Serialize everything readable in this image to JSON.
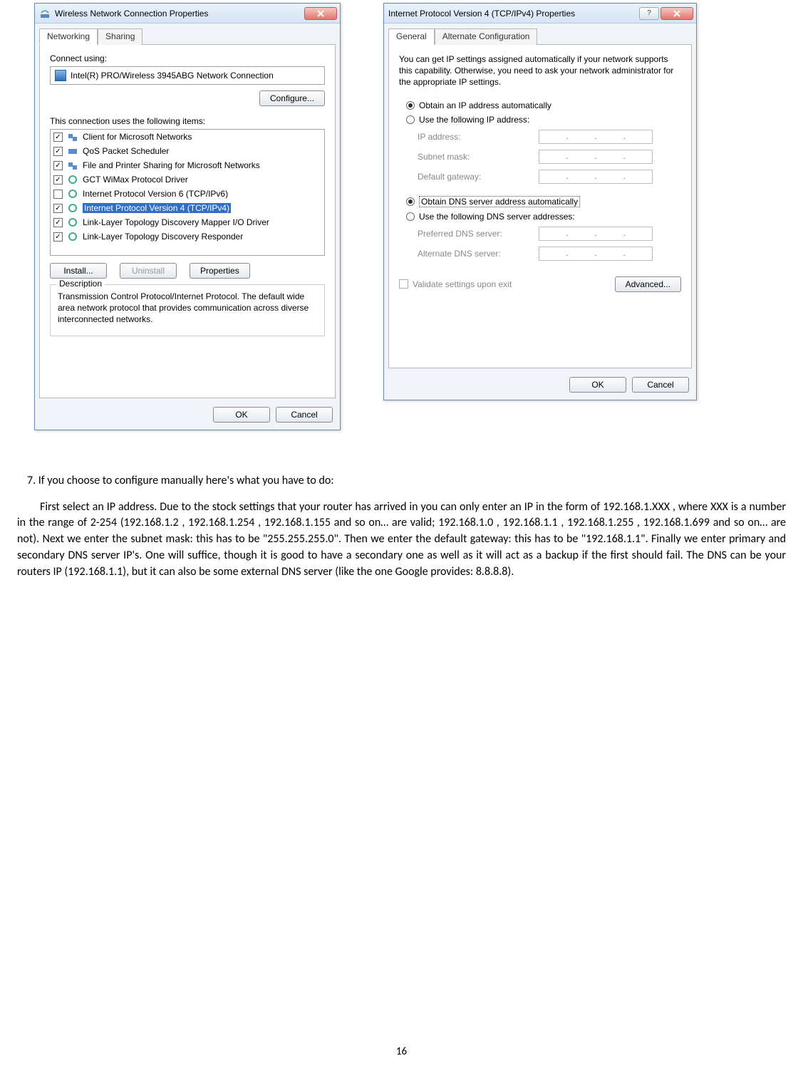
{
  "dialog1": {
    "title": "Wireless Network Connection Properties",
    "tabs": {
      "networking": "Networking",
      "sharing": "Sharing"
    },
    "connect_using_label": "Connect using:",
    "adapter": "Intel(R) PRO/Wireless 3945ABG Network Connection",
    "configure_btn": "Configure...",
    "conn_items_label": "This connection uses the following items:",
    "items": [
      {
        "checked": true,
        "label": "Client for Microsoft Networks"
      },
      {
        "checked": true,
        "label": "QoS Packet Scheduler"
      },
      {
        "checked": true,
        "label": "File and Printer Sharing for Microsoft Networks"
      },
      {
        "checked": true,
        "label": "GCT WiMax Protocol Driver"
      },
      {
        "checked": false,
        "label": "Internet Protocol Version 6 (TCP/IPv6)"
      },
      {
        "checked": true,
        "label": "Internet Protocol Version 4 (TCP/IPv4)",
        "selected": true
      },
      {
        "checked": true,
        "label": "Link-Layer Topology Discovery Mapper I/O Driver"
      },
      {
        "checked": true,
        "label": "Link-Layer Topology Discovery Responder"
      }
    ],
    "install_btn": "Install...",
    "uninstall_btn": "Uninstall",
    "properties_btn": "Properties",
    "description_legend": "Description",
    "description_text": "Transmission Control Protocol/Internet Protocol. The default wide area network protocol that provides communication across diverse interconnected networks.",
    "ok_btn": "OK",
    "cancel_btn": "Cancel"
  },
  "dialog2": {
    "title": "Internet Protocol Version 4 (TCP/IPv4) Properties",
    "tabs": {
      "general": "General",
      "alt": "Alternate Configuration"
    },
    "intro": "You can get IP settings assigned automatically if your network supports this capability. Otherwise, you need to ask your network administrator for the appropriate IP settings.",
    "radio_ip_auto": "Obtain an IP address automatically",
    "radio_ip_manual": "Use the following IP address:",
    "ip_address_label": "IP address:",
    "subnet_label": "Subnet mask:",
    "gateway_label": "Default gateway:",
    "radio_dns_auto": "Obtain DNS server address automatically",
    "radio_dns_manual": "Use the following DNS server addresses:",
    "pref_dns_label": "Preferred DNS server:",
    "alt_dns_label": "Alternate DNS server:",
    "validate_label": "Validate settings upon exit",
    "advanced_btn": "Advanced...",
    "ok_btn": "OK",
    "cancel_btn": "Cancel"
  },
  "instructions": {
    "step": "7. If you choose to configure manually here's what you have to do:",
    "paragraph": "First select an IP address. Due to the stock settings that your router has arrived in you can only enter an IP in the form of 192.168.1.XXX , where XXX is a number in the range of 2-254 (192.168.1.2 , 192.168.1.254 , 192.168.1.155 and so on… are valid; 192.168.1.0 , 192.168.1.1 , 192.168.1.255 , 192.168.1.699 and so on… are not). Next we enter the subnet mask: this has to be \"255.255.255.0\". Then we enter the default gateway: this has to be \"192.168.1.1\". Finally we enter primary and secondary DNS server IP's. One will suffice, though it is good to have a secondary one as well as it will act as a backup if the first should fail. The DNS can be your routers IP (192.168.1.1), but it can also be some external DNS server (like the one Google provides: 8.8.8.8)."
  },
  "page_number": "16"
}
